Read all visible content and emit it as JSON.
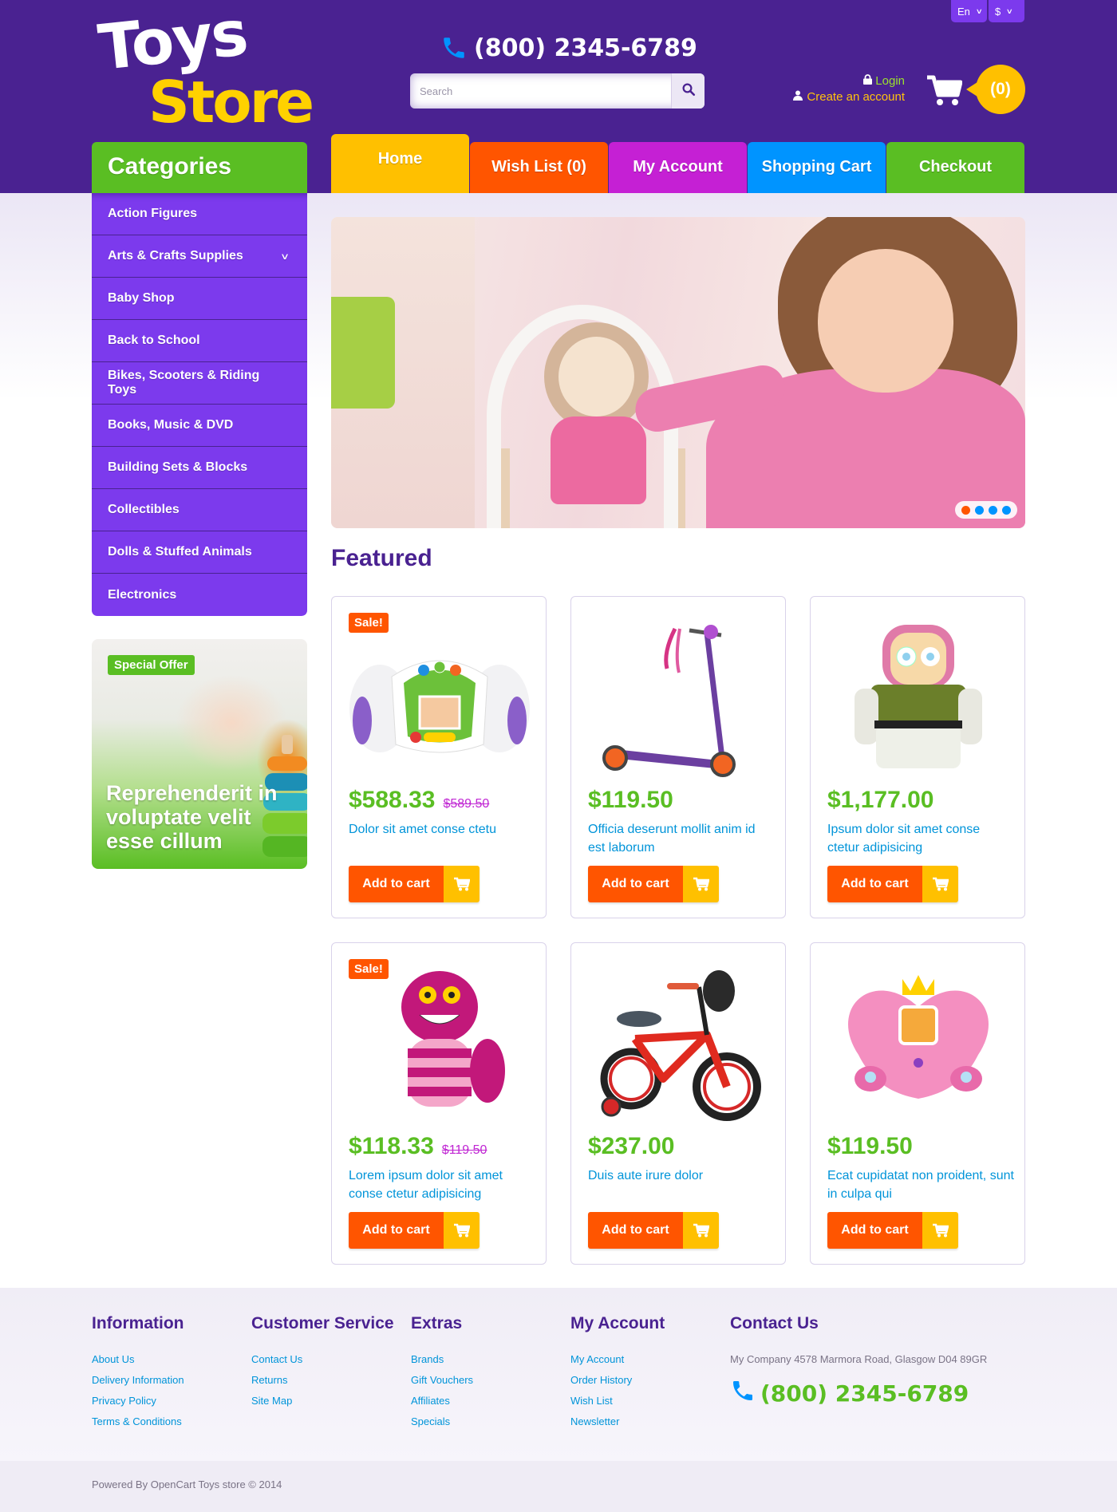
{
  "topbar": {
    "language": "En",
    "currency": "$"
  },
  "logo": {
    "line1": "Toys",
    "line2": "Store"
  },
  "header": {
    "phone": "(800) 2345-6789",
    "search_placeholder": "Search",
    "login_label": "Login",
    "create_account_label": "Create an account",
    "cart_count": "(0)"
  },
  "nav": {
    "tabs": [
      {
        "label": "Home",
        "color": "#ffc000",
        "active": true
      },
      {
        "label": "Wish List (0)",
        "color": "#ff5500"
      },
      {
        "label": "My Account",
        "color": "#c520d4"
      },
      {
        "label": "Shopping Cart",
        "color": "#0094ff"
      },
      {
        "label": "Checkout",
        "color": "#5abe23"
      }
    ]
  },
  "sidebar": {
    "title": "Categories",
    "categories": [
      {
        "label": "Action Figures"
      },
      {
        "label": "Arts & Crafts Supplies",
        "has_children": true
      },
      {
        "label": "Baby Shop"
      },
      {
        "label": "Back to School"
      },
      {
        "label": "Bikes, Scooters & Riding Toys"
      },
      {
        "label": "Books, Music & DVD"
      },
      {
        "label": "Building Sets & Blocks"
      },
      {
        "label": "Collectibles"
      },
      {
        "label": "Dolls & Stuffed Animals"
      },
      {
        "label": "Electronics"
      }
    ],
    "special_offer": {
      "badge": "Special Offer",
      "caption": "Reprehenderit in voluptate velit esse cillum"
    }
  },
  "slider": {
    "slide_count": 4,
    "active_slide": 1
  },
  "featured": {
    "title": "Featured",
    "add_to_cart_label": "Add to cart",
    "sale_label": "Sale!",
    "products": [
      {
        "name": "Dolor sit amet conse ctetu",
        "price": "$588.33",
        "old_price": "$589.50",
        "sale": true,
        "image": "kids-camera"
      },
      {
        "name": "Officia deserunt mollit anim id est laborum",
        "price": "$119.50",
        "old_price": "",
        "sale": false,
        "image": "scooter"
      },
      {
        "name": "Ipsum dolor sit amet conse ctetur adipisicing",
        "price": "$1,177.00",
        "old_price": "",
        "sale": false,
        "image": "plush-astronaut"
      },
      {
        "name": "Lorem ipsum dolor sit amet conse ctetur adipisicing",
        "price": "$118.33",
        "old_price": "$119.50",
        "sale": true,
        "image": "plush-cat"
      },
      {
        "name": "Duis aute irure dolor",
        "price": "$237.00",
        "old_price": "",
        "sale": false,
        "image": "kids-bike"
      },
      {
        "name": "Ecat cupidatat non proident, sunt in culpa qui",
        "price": "$119.50",
        "old_price": "",
        "sale": false,
        "image": "princess-toy"
      }
    ]
  },
  "footer": {
    "columns": [
      {
        "title": "Information",
        "links": [
          "About Us",
          "Delivery Information",
          "Privacy Policy",
          "Terms & Conditions"
        ]
      },
      {
        "title": "Customer Service",
        "links": [
          "Contact Us",
          "Returns",
          "Site Map"
        ]
      },
      {
        "title": "Extras",
        "links": [
          "Brands",
          "Gift Vouchers",
          "Affiliates",
          "Specials"
        ]
      },
      {
        "title": "My Account",
        "links": [
          "My Account",
          "Order History",
          "Wish List",
          "Newsletter"
        ]
      }
    ],
    "contact": {
      "title": "Contact Us",
      "address": "My Company 4578 Marmora Road, Glasgow D04 89GR",
      "phone": "(800) 2345-6789"
    },
    "copyright": "Powered By OpenCart Toys store © 2014"
  },
  "colors": {
    "header_bg": "#4a2291",
    "category_bg": "#7c3aed",
    "green": "#5abe23",
    "orange": "#ff5500",
    "yellow": "#ffc000",
    "blue": "#0094ff",
    "magenta": "#c520d4"
  }
}
